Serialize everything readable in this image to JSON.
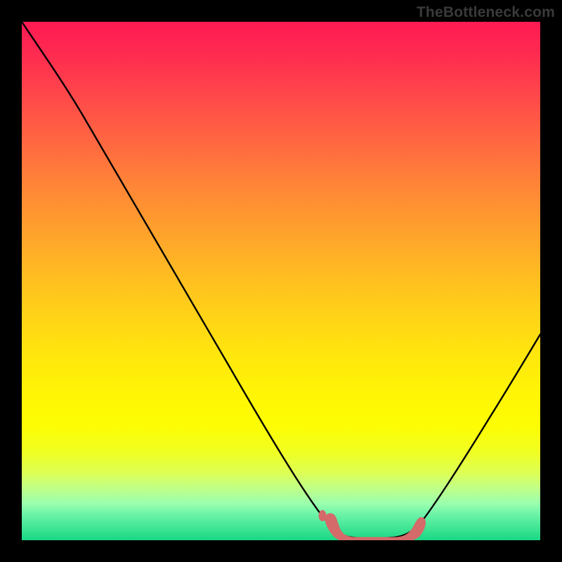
{
  "watermark": "TheBottleneck.com",
  "chart_data": {
    "type": "line",
    "title": "",
    "xlabel": "",
    "ylabel": "",
    "xlim": [
      0,
      100
    ],
    "ylim": [
      0,
      100
    ],
    "series": [
      {
        "name": "bottleneck-curve",
        "x": [
          0,
          4,
          10,
          16,
          22,
          28,
          34,
          40,
          46,
          52,
          56,
          60,
          64,
          68,
          72,
          76,
          80,
          84,
          88,
          92,
          96,
          100
        ],
        "values": [
          100,
          95,
          86,
          77,
          68,
          59,
          50,
          41,
          32,
          19,
          10,
          4,
          1,
          0.5,
          0.5,
          1,
          5,
          12,
          20,
          28,
          36,
          44
        ]
      }
    ],
    "annotations": [
      {
        "name": "optimal-marker",
        "type": "blob",
        "x_range": [
          58,
          75
        ],
        "y_range": [
          0,
          4
        ],
        "color": "#d96a6a"
      }
    ],
    "background": {
      "type": "vertical-gradient",
      "stops": [
        {
          "pos": 0,
          "color": "#ff1a53"
        },
        {
          "pos": 50,
          "color": "#ffc020"
        },
        {
          "pos": 80,
          "color": "#fdfd04"
        },
        {
          "pos": 100,
          "color": "#18d784"
        }
      ]
    }
  }
}
